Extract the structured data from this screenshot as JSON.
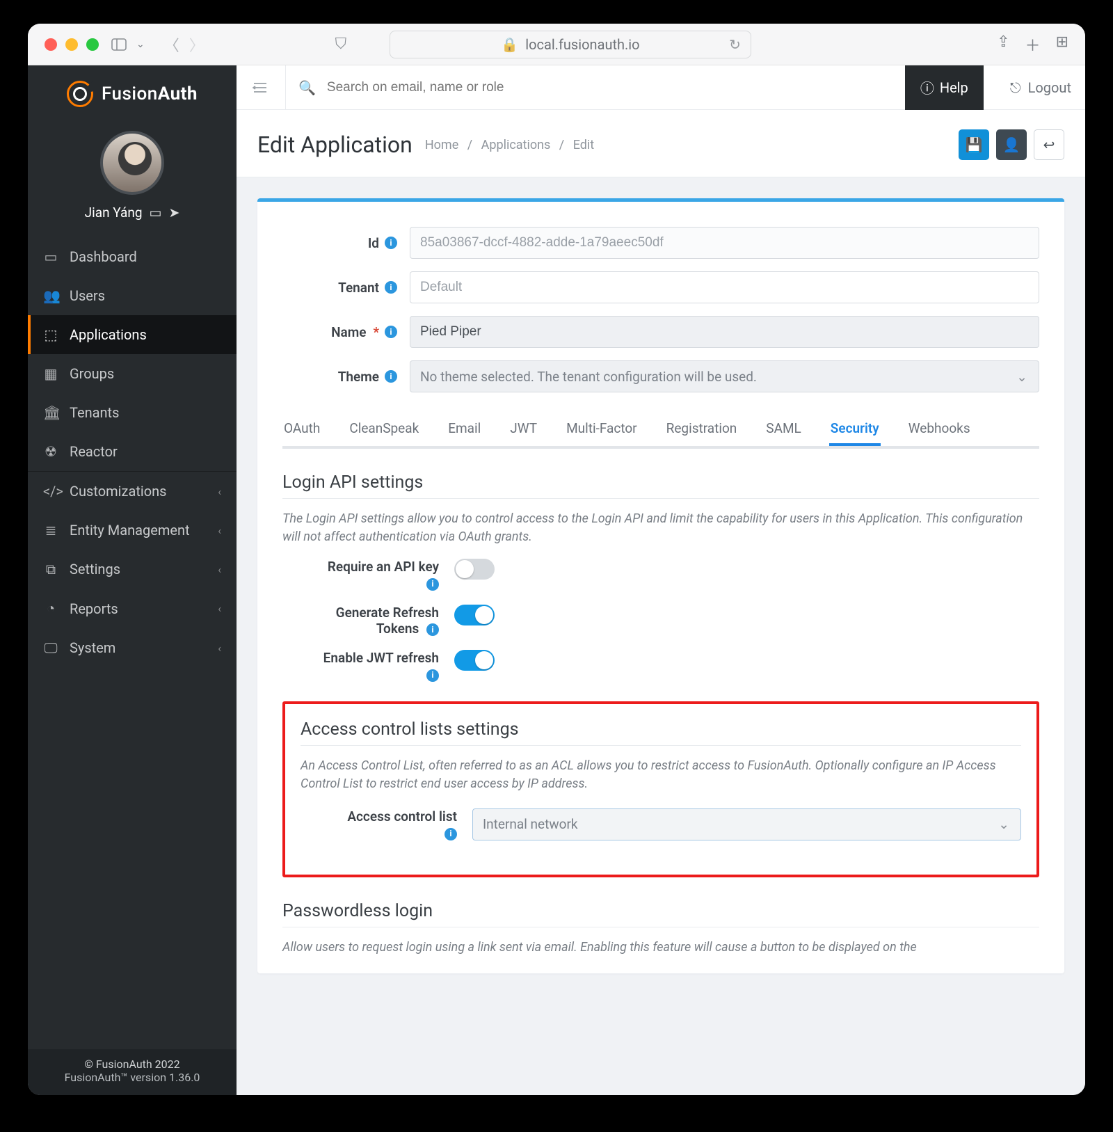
{
  "browser": {
    "address": "local.fusionauth.io"
  },
  "brand": {
    "part1": "Fusion",
    "part2": "Auth"
  },
  "user": {
    "name": "Jian Yáng"
  },
  "topbar": {
    "search_placeholder": "Search on email, name or role",
    "help_label": "Help",
    "logout_label": "Logout"
  },
  "sidebar": {
    "items": [
      {
        "icon": "▭",
        "label": "Dashboard"
      },
      {
        "icon": "👥",
        "label": "Users"
      },
      {
        "icon": "⬚",
        "label": "Applications"
      },
      {
        "icon": "▦",
        "label": "Groups"
      },
      {
        "icon": "🏛",
        "label": "Tenants"
      },
      {
        "icon": "☢",
        "label": "Reactor"
      }
    ],
    "items2": [
      {
        "icon": "</>",
        "label": "Customizations"
      },
      {
        "icon": "≣",
        "label": "Entity Management"
      },
      {
        "icon": "⧉",
        "label": "Settings"
      },
      {
        "icon": "◔",
        "label": "Reports"
      },
      {
        "icon": "🖵",
        "label": "System"
      }
    ],
    "footer": {
      "line1": "© FusionAuth 2022",
      "line2": "FusionAuth™ version 1.36.0"
    }
  },
  "page": {
    "title": "Edit Application",
    "crumbs": [
      "Home",
      "Applications",
      "Edit"
    ]
  },
  "form": {
    "id": {
      "label": "Id",
      "value": "85a03867-dccf-4882-adde-1a79aeec50df"
    },
    "tenant": {
      "label": "Tenant",
      "value": "Default"
    },
    "name": {
      "label": "Name",
      "value": "Pied Piper"
    },
    "theme": {
      "label": "Theme",
      "value": "No theme selected. The tenant configuration will be used."
    }
  },
  "tabs": [
    "OAuth",
    "CleanSpeak",
    "Email",
    "JWT",
    "Multi-Factor",
    "Registration",
    "SAML",
    "Security",
    "Webhooks"
  ],
  "login_api": {
    "heading": "Login API settings",
    "desc": "The Login API settings allow you to control access to the Login API and limit the capability for users in this Application. This configuration will not affect authentication via OAuth grants.",
    "require_label": "Require an API key",
    "generate_label_l1": "Generate Refresh",
    "generate_label_l2": "Tokens",
    "enable_label": "Enable JWT refresh"
  },
  "acl": {
    "heading": "Access control lists settings",
    "desc": "An Access Control List, often referred to as an ACL allows you to restrict access to FusionAuth. Optionally configure an IP Access Control List to restrict end user access by IP address.",
    "select_label": "Access control list",
    "select_value": "Internal network"
  },
  "passwordless": {
    "heading": "Passwordless login",
    "desc": "Allow users to request login using a link sent via email. Enabling this feature will cause a button to be displayed on the"
  }
}
